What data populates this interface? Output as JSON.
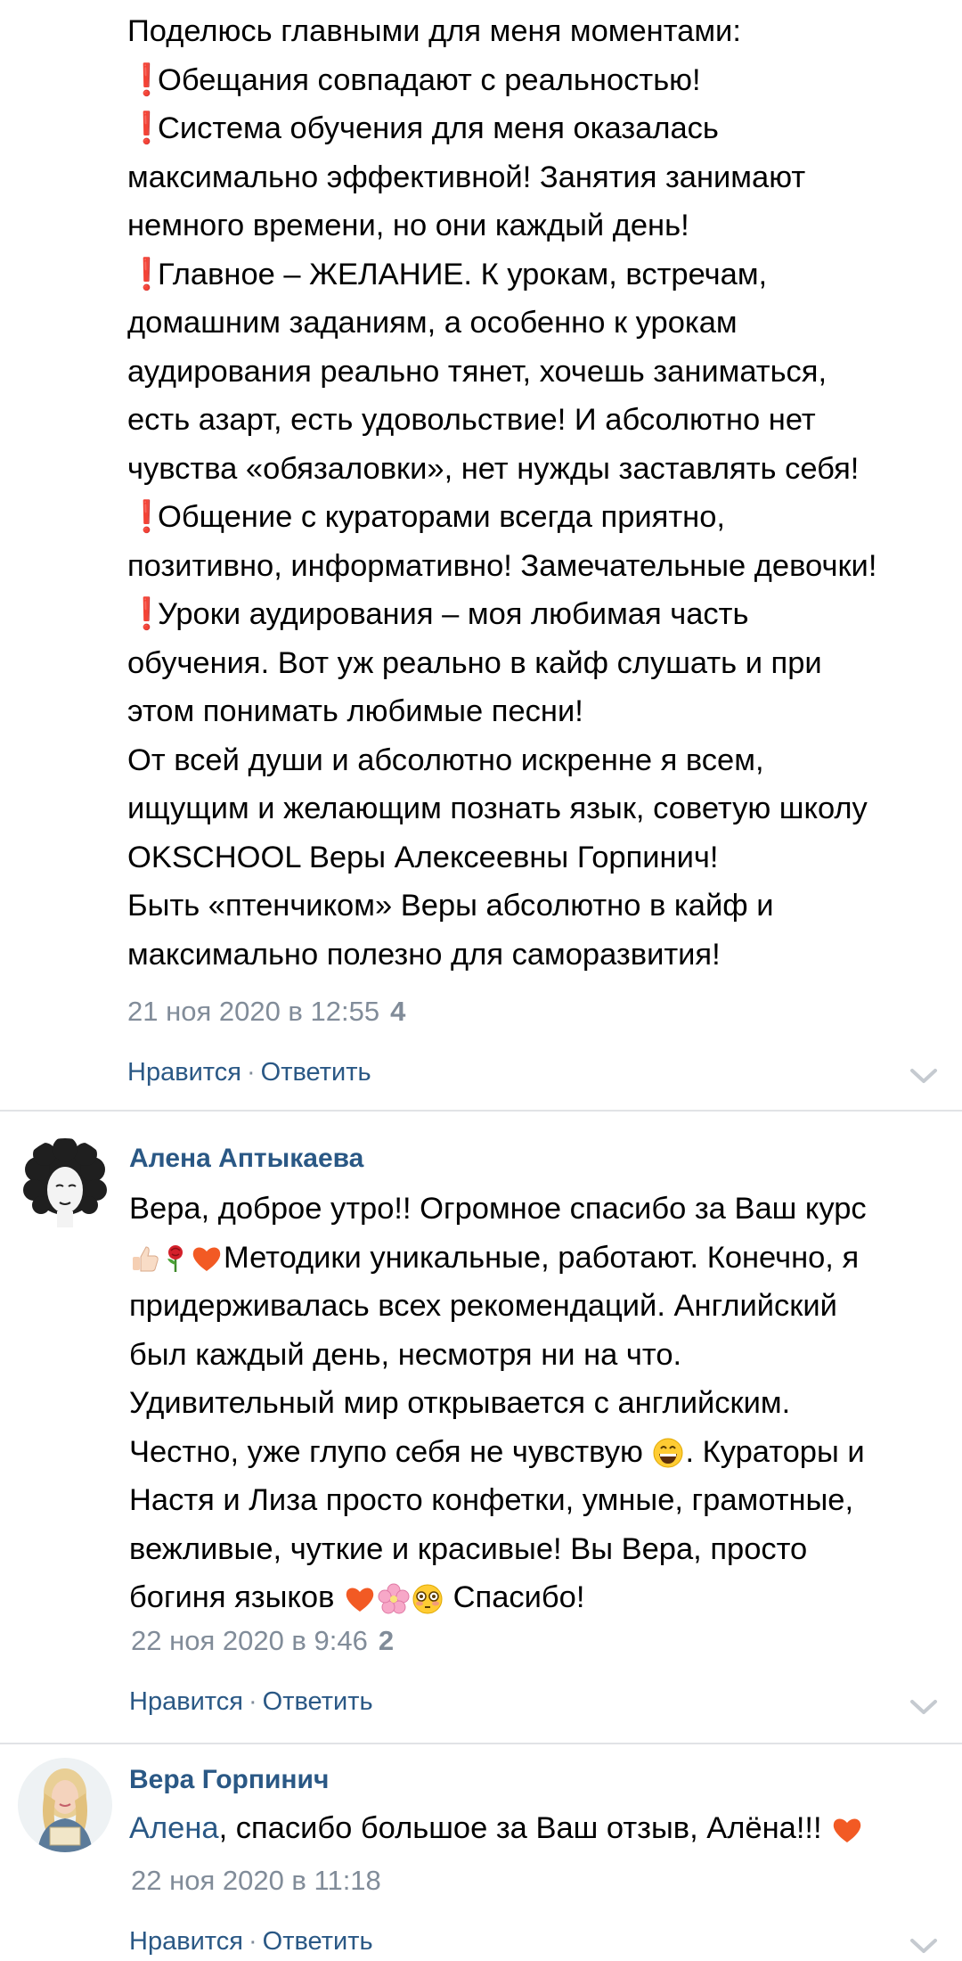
{
  "comment1": {
    "lines": [
      "Поделюсь главными для меня моментами:",
      "Обещания совпадают с реальностью!",
      "Система обучения для меня оказалась",
      "максимально эффективной! Занятия занимают",
      "немного времени, но они каждый день!",
      "Главное – ЖЕЛАНИЕ. К урокам, встречам,",
      "домашним заданиям, а особенно к урокам",
      "аудирования реально тянет, хочешь заниматься,",
      "есть азарт, есть удовольствие! И абсолютно нет",
      "чувства «обязаловки», нет нужды заставлять себя!",
      "Общение с кураторами всегда приятно,",
      "позитивно, информативно! Замечательные девочки!",
      "Уроки аудирования – моя любимая часть",
      "обучения. Вот уж реально в кайф слушать и при",
      "этом понимать любимые песни!",
      "От всей души и абсолютно искренне я всем,",
      "ищущим и желающим познать язык, советую школу",
      "OKSCHOOL Веры Алексеевны Горпинич!",
      "Быть «птенчиком» Веры абсолютно в кайф и",
      "максимально полезно для саморазвития!"
    ],
    "exclamation": "❗",
    "timestamp": "21 ноя 2020 в 12:55",
    "likes": "4",
    "like_label": "Нравится",
    "separator": "·",
    "reply_label": "Ответить"
  },
  "comment2": {
    "author": "Алена Аптыкаева",
    "lines": {
      "l1": "Вера, доброе утро!! Огромное спасибо за Ваш курс",
      "l2": "Методики уникальные, работают. Конечно, я",
      "l3": "придерживалась всех рекомендаций. Английский",
      "l4": "был каждый день, несмотря ни на что.",
      "l5": "Удивительный мир открывается с английским.",
      "l6a": "Честно, уже глупо себя не чувствую",
      "l6b": ". Кураторы и",
      "l7": "Настя и Лиза просто конфетки, умные, грамотные,",
      "l8": "вежливые, чуткие и красивые! Вы Вера, просто",
      "l9a": "богиня языков",
      "l9b": "Спасибо!"
    },
    "emojis": [
      "thumbs-up",
      "rose",
      "heart",
      "grinning-face",
      "heart",
      "cherry-blossom",
      "flushed-face"
    ],
    "timestamp": "22 ноя 2020 в 9:46",
    "likes": "2",
    "like_label": "Нравится",
    "separator": "·",
    "reply_label": "Ответить"
  },
  "comment3": {
    "author": "Вера Горпинич",
    "mention": "Алена",
    "text": ", спасибо большое за Ваш отзыв, Алёна!!!",
    "emojis": [
      "heart"
    ],
    "timestamp": "22 ноя 2020 в 11:18",
    "like_label": "Нравится",
    "separator": "·",
    "reply_label": "Ответить"
  },
  "colors": {
    "link": "#2a5885",
    "meta": "#818c99",
    "accent_red": "#e01b1b",
    "heart": "#f25a24",
    "divider": "#e1e3e6"
  }
}
